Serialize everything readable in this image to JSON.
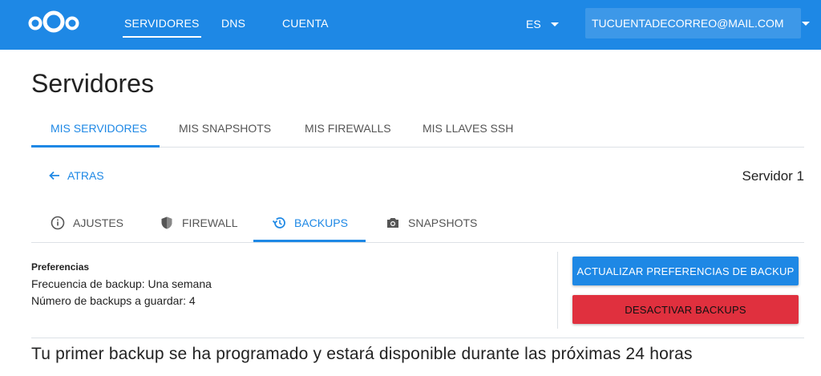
{
  "header": {
    "logo_icon": "nextcloud-logo-icon",
    "nav": [
      {
        "label": "SERVIDORES",
        "active": true
      },
      {
        "label": "DNS",
        "active": false
      },
      {
        "label": "CUENTA",
        "active": false
      }
    ],
    "language": "ES",
    "account_email": "TUCUENTADECORREO@MAIL.COM",
    "bar_color": "#1e88e5"
  },
  "page": {
    "title": "Servidores",
    "tabs": [
      {
        "label": "MIS SERVIDORES",
        "active": true
      },
      {
        "label": "MIS SNAPSHOTS",
        "active": false
      },
      {
        "label": "MIS FIREWALLS",
        "active": false
      },
      {
        "label": "MIS LLAVES SSH",
        "active": false
      }
    ]
  },
  "server": {
    "back_label": "ATRAS",
    "name": "Servidor 1",
    "tabs": [
      {
        "label": "AJUSTES",
        "icon": "info-icon",
        "active": false
      },
      {
        "label": "FIREWALL",
        "icon": "shield-icon",
        "active": false
      },
      {
        "label": "BACKUPS",
        "icon": "history-icon",
        "active": true
      },
      {
        "label": "SNAPSHOTS",
        "icon": "camera-icon",
        "active": false
      }
    ]
  },
  "backups": {
    "preferences_label": "Preferencias",
    "frequency": "Frecuencia de backup: Una semana",
    "count": "Número de backups a guardar: 4",
    "update_button": "ACTUALIZAR PREFERENCIAS DE BACKUP",
    "disable_button": "DESACTIVAR BACKUPS",
    "notice": "Tu primer backup se ha programado y estará disponible durante las próximas 24 horas",
    "accent_color": "#1e88e5",
    "danger_color": "#e0303e"
  }
}
